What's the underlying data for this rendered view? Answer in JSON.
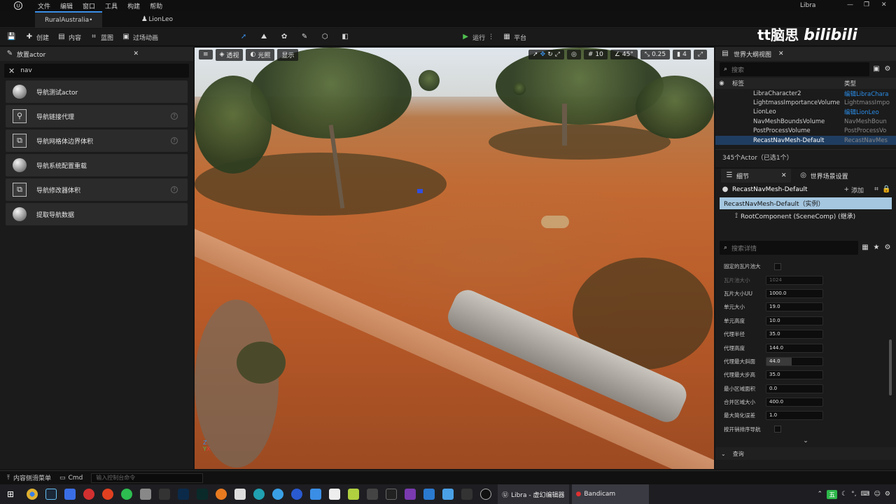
{
  "titlebar": {
    "menu": [
      "文件",
      "编辑",
      "窗口",
      "工具",
      "构建",
      "帮助"
    ],
    "app_title": "Libra"
  },
  "tabs": [
    {
      "label": "RuralAustralia•"
    },
    {
      "label": "LionLeo"
    }
  ],
  "toolbar": {
    "create": "创建",
    "content": "内容",
    "blueprint": "蓝图",
    "cinematics": "过场动画",
    "play": "运行",
    "platform": "平台"
  },
  "watermark": {
    "text1": "tt脑思",
    "text2": "bilibili"
  },
  "place_actors": {
    "tab": "放置actor",
    "search_value": "nav",
    "items": [
      {
        "label": "导航测试actor",
        "icon": "sphere-icon"
      },
      {
        "label": "导航链接代理",
        "icon": "nav-link-icon"
      },
      {
        "label": "导航网格体边界体积",
        "icon": "volume-icon"
      },
      {
        "label": "导航系统配置重载",
        "icon": "sphere-icon"
      },
      {
        "label": "导航修改器体积",
        "icon": "volume-icon"
      },
      {
        "label": "提取导航数据",
        "icon": "sphere-icon"
      }
    ]
  },
  "viewport": {
    "view_mode": "透视",
    "lighting": "光照",
    "show": "显示",
    "grid_snap": "10",
    "rot_snap": "45°",
    "scale_snap": "0.25",
    "cam_speed": "4"
  },
  "outliner": {
    "tab": "世界大纲视图",
    "search_placeholder": "搜索",
    "col_label": "标签",
    "col_type": "类型",
    "rows": [
      {
        "name": "LibraCharacter2",
        "type": "编辑LibraChara"
      },
      {
        "name": "LightmassImportanceVolume",
        "type": "LightmassImpo"
      },
      {
        "name": "LionLeo",
        "type": "编辑LionLeo"
      },
      {
        "name": "NavMeshBoundsVolume",
        "type": "NavMeshBoun"
      },
      {
        "name": "PostProcessVolume",
        "type": "PostProcessVo"
      },
      {
        "name": "RecastNavMesh-Default",
        "type": "RecastNavMes"
      }
    ],
    "count": "345个Actor（已选1个）"
  },
  "details": {
    "tab": "细节",
    "tab2": "世界场景设置",
    "actor_name": "RecastNavMesh-Default",
    "add_label": "添加",
    "instance": "RecastNavMesh-Default（实例）",
    "root": "RootComponent (SceneComp) (继承)",
    "search_placeholder": "搜索详情",
    "properties": [
      {
        "label": "固定的瓦片池大",
        "value": ""
      },
      {
        "label": "瓦片池大小",
        "value": "1024"
      },
      {
        "label": "瓦片大小UU",
        "value": "1000.0"
      },
      {
        "label": "单元大小",
        "value": "19.0"
      },
      {
        "label": "单元高度",
        "value": "10.0"
      },
      {
        "label": "代理半径",
        "value": "35.0"
      },
      {
        "label": "代理高度",
        "value": "144.0"
      },
      {
        "label": "代理最大斜面",
        "value": "44.0"
      },
      {
        "label": "代理最大步高",
        "value": "35.0"
      },
      {
        "label": "最小区域面积",
        "value": "0.0"
      },
      {
        "label": "合并区域大小",
        "value": "400.0"
      },
      {
        "label": "最大简化误差",
        "value": "1.0"
      },
      {
        "label": "按开销排序导航",
        "value": ""
      }
    ],
    "query_section": "查询"
  },
  "bottom": {
    "drawer": "内容侧滑菜单",
    "cmd": "Cmd",
    "console_placeholder": "输入控制台命令"
  },
  "taskbar": {
    "active_app": "Libra - 虚幻编辑器",
    "recording": "Bandicam",
    "ime": "五"
  }
}
